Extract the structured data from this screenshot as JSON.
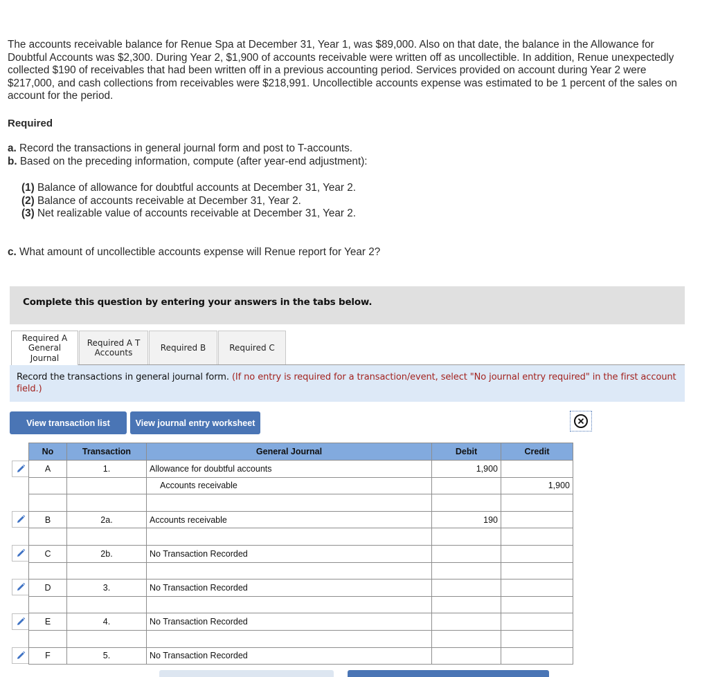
{
  "problem": {
    "text": "The accounts receivable balance for Renue Spa at December 31, Year 1, was $89,000. Also on that date, the balance in the Allowance for Doubtful Accounts was $2,300. During Year 2, $1,900 of accounts receivable were written off as uncollectible. In addition, Renue unexpectedly collected $190 of receivables that had been written off in a previous accounting period. Services provided on account during Year 2 were $217,000, and cash collections from receivables were $218,991. Uncollectible accounts expense was estimated to be 1 percent of the sales on account for the period."
  },
  "required": {
    "heading": "Required",
    "a": {
      "label": "a.",
      "text": " Record the transactions in general journal form and post to T-accounts."
    },
    "b": {
      "label": "b.",
      "text": " Based on the preceding information, compute (after year-end adjustment):"
    },
    "b_items": [
      {
        "label": "(1)",
        "text": " Balance of allowance for doubtful accounts at December 31, Year 2."
      },
      {
        "label": "(2)",
        "text": " Balance of accounts receivable at December 31, Year 2."
      },
      {
        "label": "(3)",
        "text": " Net realizable value of accounts receivable at December 31, Year 2."
      }
    ],
    "c": {
      "label": "c.",
      "text": " What amount of uncollectible accounts expense will Renue report for Year 2?"
    }
  },
  "instruction": "Complete this question by entering your answers in the tabs below.",
  "tabs": [
    {
      "label": "Required A General Journal",
      "active": true
    },
    {
      "label": "Required A T Accounts",
      "active": false
    },
    {
      "label": "Required B",
      "active": false
    },
    {
      "label": "Required C",
      "active": false
    }
  ],
  "panel": {
    "message": "Record the transactions in general journal form.",
    "note": "(If no entry is required for a transaction/event, select \"No journal entry required\" in the first account field.)"
  },
  "buttons": {
    "view_transaction_list": "View transaction list",
    "view_journal_entry_worksheet": "View journal entry worksheet"
  },
  "journal": {
    "headers": {
      "no": "No",
      "transaction": "Transaction",
      "general_journal": "General Journal",
      "debit": "Debit",
      "credit": "Credit"
    },
    "rows": [
      {
        "no": "A",
        "transaction": "1.",
        "account": "Allowance for doubtful accounts",
        "debit": "1,900",
        "credit": "",
        "indent": false,
        "editable": true
      },
      {
        "no": "",
        "transaction": "",
        "account": "Accounts receivable",
        "debit": "",
        "credit": "1,900",
        "indent": true,
        "editable": false
      },
      {
        "no": "",
        "transaction": "",
        "account": "",
        "debit": "",
        "credit": "",
        "indent": false,
        "editable": false
      },
      {
        "no": "B",
        "transaction": "2a.",
        "account": "Accounts receivable",
        "debit": "190",
        "credit": "",
        "indent": false,
        "editable": true
      },
      {
        "no": "",
        "transaction": "",
        "account": "",
        "debit": "",
        "credit": "",
        "indent": false,
        "editable": false
      },
      {
        "no": "C",
        "transaction": "2b.",
        "account": "No Transaction Recorded",
        "debit": "",
        "credit": "",
        "indent": false,
        "editable": true
      },
      {
        "no": "",
        "transaction": "",
        "account": "",
        "debit": "",
        "credit": "",
        "indent": false,
        "editable": false
      },
      {
        "no": "D",
        "transaction": "3.",
        "account": "No Transaction Recorded",
        "debit": "",
        "credit": "",
        "indent": false,
        "editable": true
      },
      {
        "no": "",
        "transaction": "",
        "account": "",
        "debit": "",
        "credit": "",
        "indent": false,
        "editable": false
      },
      {
        "no": "E",
        "transaction": "4.",
        "account": "No Transaction Recorded",
        "debit": "",
        "credit": "",
        "indent": false,
        "editable": true
      },
      {
        "no": "",
        "transaction": "",
        "account": "",
        "debit": "",
        "credit": "",
        "indent": false,
        "editable": false
      },
      {
        "no": "F",
        "transaction": "5.",
        "account": "No Transaction Recorded",
        "debit": "",
        "credit": "",
        "indent": false,
        "editable": true
      }
    ]
  },
  "colors": {
    "accent_blue": "#4a75b5",
    "header_blue": "#82aade",
    "panel_blue": "#dde9f7",
    "note_red": "#a3231f",
    "instruction_gray": "#e0e0e0"
  }
}
